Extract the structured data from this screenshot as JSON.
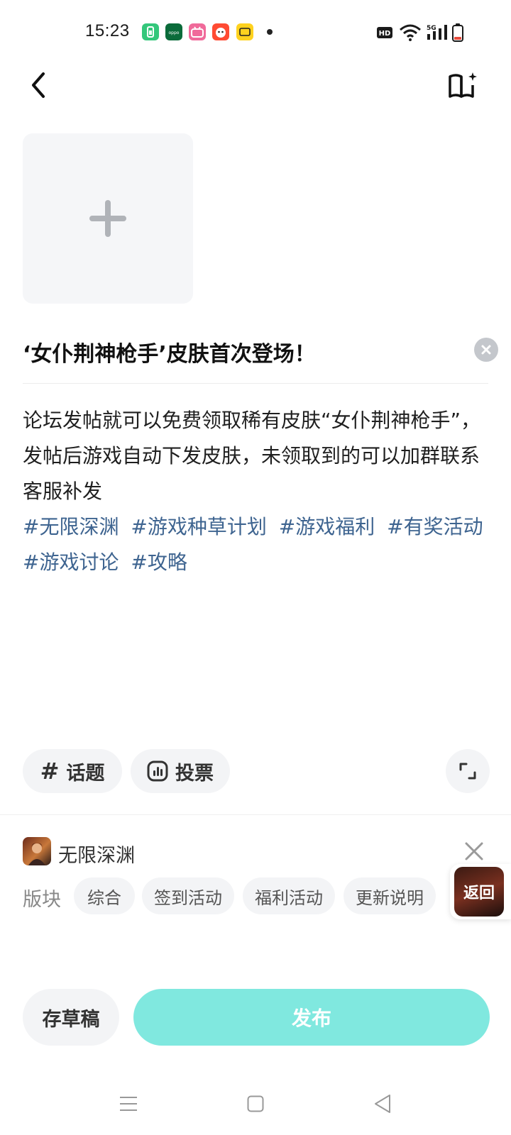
{
  "status_bar": {
    "time": "15:23",
    "hd_badge": "HD",
    "network": "5G",
    "app_icons": [
      "battery-saver-app-icon",
      "oppo-app-icon",
      "bilibili-app-icon",
      "taobao-app-icon",
      "meituan-app-icon"
    ]
  },
  "header": {
    "back_icon": "chevron-left-icon",
    "action_icon": "book-sparkle-icon"
  },
  "composer": {
    "add_image_icon": "plus-icon",
    "title": "‘女仆荆神枪手’皮肤首次登场！",
    "body": "论坛发帖就可以免费领取稀有皮肤“女仆荆神枪手”，发帖后游戏自动下发皮肤，未领取到的可以加群联系客服补发",
    "tags": [
      "#无限深渊",
      "#游戏种草计划",
      "#游戏福利",
      "#有奖活动",
      "#游戏讨论",
      "#攻略"
    ]
  },
  "tools": {
    "topic_label": "话题",
    "vote_label": "投票"
  },
  "game": {
    "name": "无限深渊",
    "board_label": "版块",
    "boards": [
      "综合",
      "签到活动",
      "福利活动",
      "更新说明"
    ]
  },
  "floating": {
    "return_label": "返回"
  },
  "actions": {
    "draft_label": "存草稿",
    "publish_label": "发布"
  },
  "colors": {
    "accent": "#80e8df",
    "tag": "#3e6490",
    "chip_bg": "#f3f4f6"
  }
}
